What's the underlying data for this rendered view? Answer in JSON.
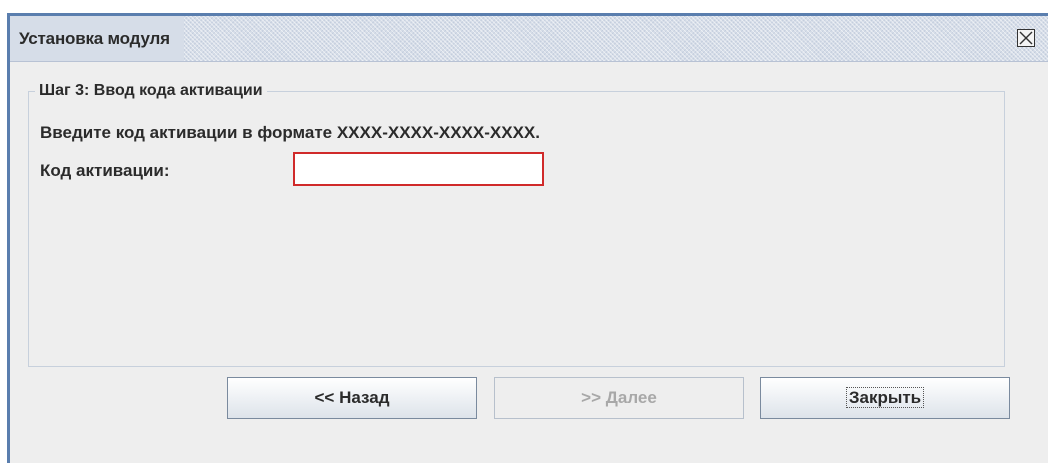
{
  "window": {
    "title": "Установка модуля"
  },
  "step": {
    "title": "Шаг 3: Ввод кода активации",
    "instruction": "Введите код активации в формате XXXX-XXXX-XXXX-XXXX.",
    "field_label": "Код активации:",
    "field_value": ""
  },
  "buttons": {
    "back": "<< Назад",
    "next": ">> Далее",
    "close": "Закрыть"
  },
  "colors": {
    "window_border": "#5a7eae",
    "input_error_border": "#d02a2a",
    "disabled_text": "#a8a8a8"
  },
  "icons": {
    "close": "close-icon"
  }
}
